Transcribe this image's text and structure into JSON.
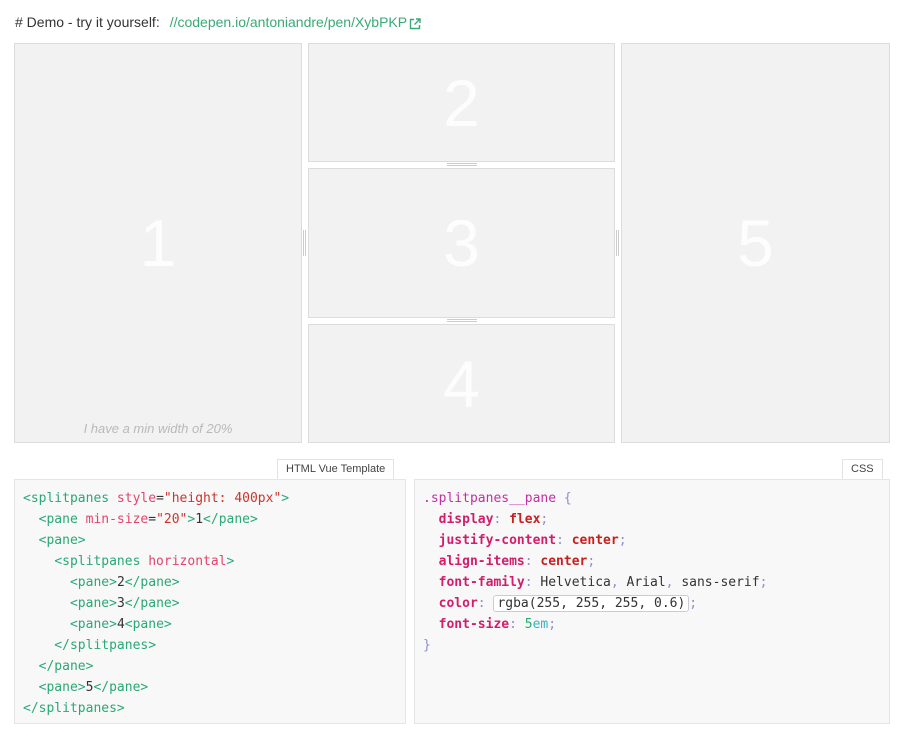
{
  "demo": {
    "label": "# Demo - try it yourself:",
    "link_text": "//codepen.io/antoniandre/pen/XybPKP",
    "link_color": "#3aa978"
  },
  "panes": {
    "p1": "1",
    "p2": "2",
    "p3": "3",
    "p4": "4",
    "p5": "5",
    "min_note": "I have a min width of 20%"
  },
  "tabs": {
    "html": "HTML Vue Template",
    "css": "CSS"
  },
  "html_code": {
    "l1_tag1": "<splitpanes",
    "l1_attr": "style",
    "l1_eq": "=",
    "l1_str": "\"height: 400px\"",
    "l1_tag2": ">",
    "l2_indent": "  ",
    "l2_tag1": "<pane",
    "l2_attr": "min-size",
    "l2_eq": "=",
    "l2_str": "\"20\"",
    "l2_tag2": ">",
    "l2_txt": "1",
    "l2_tag3": "</pane>",
    "l3": "  <pane>",
    "l4_indent": "    ",
    "l4_tag1": "<splitpanes",
    "l4_attr": "horizontal",
    "l4_tag2": ">",
    "l5_indent": "      ",
    "l5_tag1": "<pane>",
    "l5_txt": "2",
    "l5_tag2": "</pane>",
    "l6_tag1": "<pane>",
    "l6_txt": "3",
    "l6_tag2": "</pane>",
    "l7_tag1": "<pane>",
    "l7_txt": "4",
    "l7_tag2": "<pane>",
    "l8": "    </splitpanes>",
    "l9": "  </pane>",
    "l10_tag1": "<pane>",
    "l10_txt": "5",
    "l10_tag2": "</pane>",
    "l11": "</splitpanes>"
  },
  "css_code": {
    "selector": ".splitpanes__pane",
    "open": "{",
    "p1": "display",
    "v1": "flex",
    "p2": "justify-content",
    "v2": "center",
    "p3": "align-items",
    "v3": "center",
    "p4": "font-family",
    "v4a": "Helvetica",
    "v4b": "Arial",
    "v4c": "sans-serif",
    "p5": "color",
    "v5": "rgba(255, 255, 255, 0.6)",
    "p6": "font-size",
    "v6num": "5",
    "v6unit": "em",
    "close": "}",
    "colon": ":",
    "semi": ";",
    "comma": ","
  }
}
